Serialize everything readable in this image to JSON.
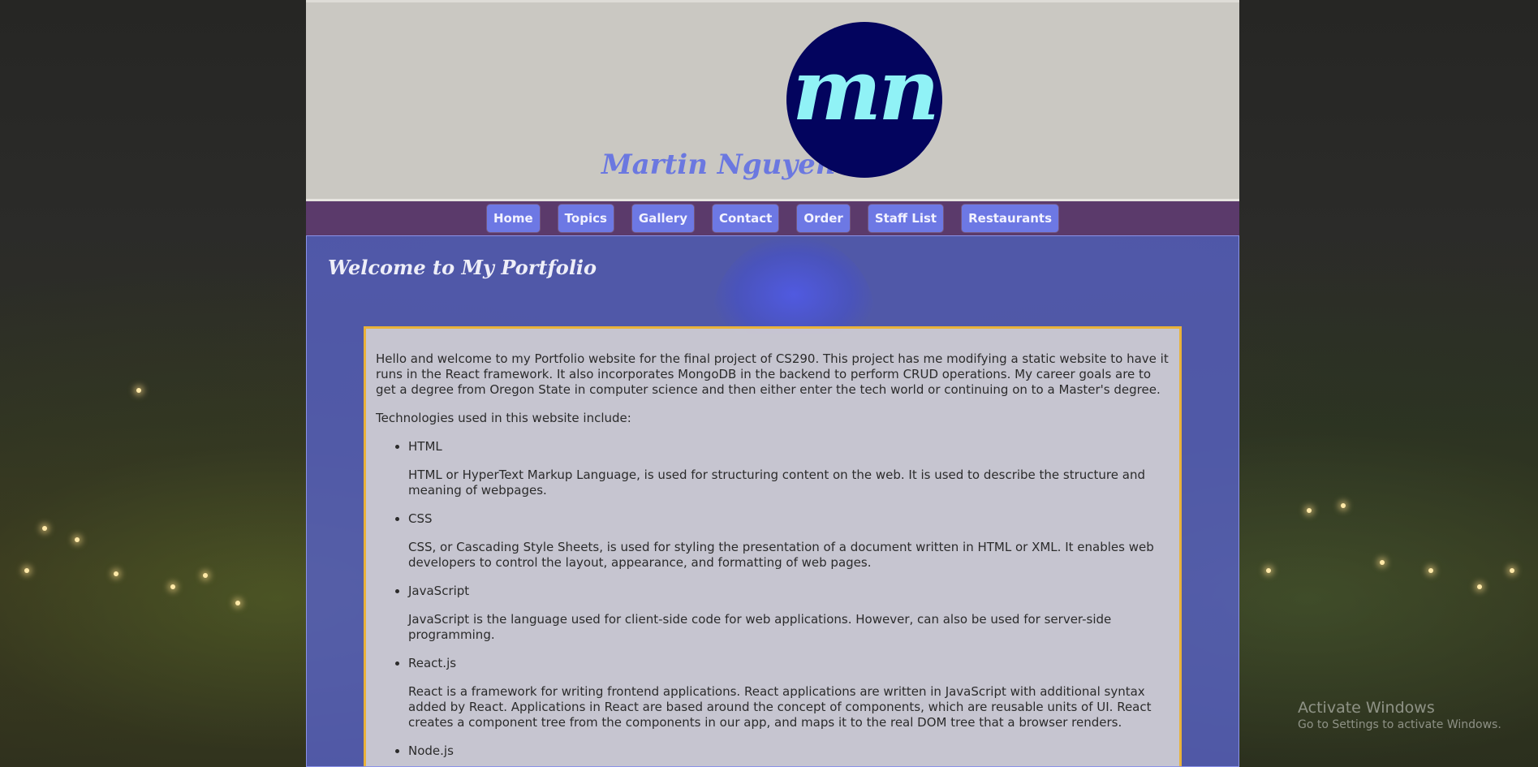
{
  "header": {
    "site_title": "Martin Nguyen",
    "logo_text": "mn"
  },
  "nav": {
    "items": [
      {
        "label": "Home"
      },
      {
        "label": "Topics"
      },
      {
        "label": "Gallery"
      },
      {
        "label": "Contact"
      },
      {
        "label": "Order"
      },
      {
        "label": "Staff List"
      },
      {
        "label": "Restaurants"
      }
    ]
  },
  "main": {
    "heading": "Welcome to My Portfolio",
    "intro": "Hello and welcome to my Portfolio website for the final project of CS290. This project has me modifying a static website to have it runs in the React framework. It also incorporates MongoDB in the backend to perform CRUD operations. My career goals are to get a degree from Oregon State in computer science and then either enter the tech world or continuing on to a Master's degree.",
    "tech_intro": "Technologies used in this website include:",
    "technologies": [
      {
        "name": "HTML",
        "description": "HTML or HyperText Markup Language, is used for structuring content on the web. It is used to describe the structure and meaning of webpages."
      },
      {
        "name": "CSS",
        "description": "CSS, or Cascading Style Sheets, is used for styling the presentation of a document written in HTML or XML. It enables web developers to control the layout, appearance, and formatting of web pages."
      },
      {
        "name": "JavaScript",
        "description": "JavaScript is the language used for client-side code for web applications. However, can also be used for server-side programming."
      },
      {
        "name": "React.js",
        "description": "React is a framework for writing frontend applications. React applications are written in JavaScript with additional syntax added by React. Applications in React are based around the concept of components, which are reusable units of UI. React creates a component tree from the components in our app, and maps it to the real DOM tree that a browser renders."
      },
      {
        "name": "Node.js",
        "description": ""
      }
    ]
  },
  "watermark": {
    "title": "Activate Windows",
    "subtitle": "Go to Settings to activate Windows."
  },
  "colors": {
    "header_bg": "#cac8c2",
    "title": "#6b78e0",
    "logo_bg": "#03045e",
    "logo_text": "#90f2f6",
    "nav_bg": "#5b3a6b",
    "nav_button": "#6d78e4",
    "main_bg": "#5862c4",
    "article_border": "#e9b23a"
  }
}
